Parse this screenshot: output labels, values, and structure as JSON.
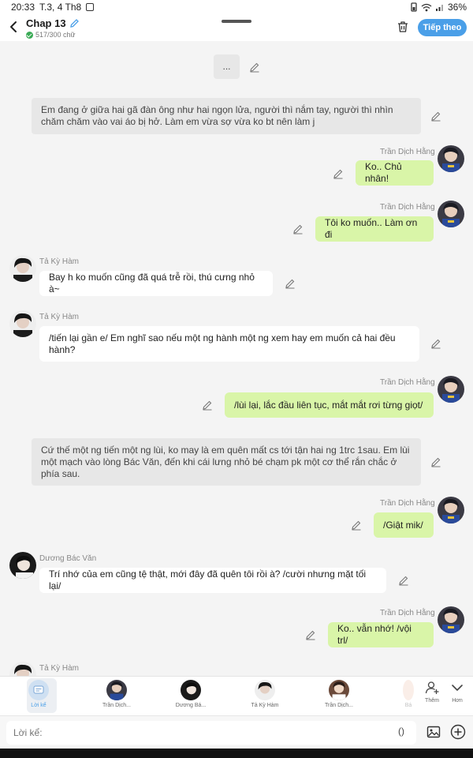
{
  "status_bar": {
    "time": "20:33",
    "date": "T.3, 4 Th8",
    "battery": "36%"
  },
  "header": {
    "title": "Chap 13",
    "word_count": "517/300 chữ",
    "next_label": "Tiếp theo"
  },
  "messages": [
    {
      "kind": "narration",
      "text": "..."
    },
    {
      "kind": "narration",
      "text": "Em đang ở giữa hai gã đàn ông như hai ngọn lửa, người thì nắm tay, người thì nhìn chăm chăm vào vai áo bị hở. Làm em vừa sợ vừa ko bt nên làm j"
    },
    {
      "kind": "right",
      "sender": "Trần Dịch Hằng",
      "text": "Ko.. Chủ nhân!"
    },
    {
      "kind": "right",
      "sender": "Trần Dịch Hằng",
      "text": "Tôi ko muốn.. Làm ơn đi"
    },
    {
      "kind": "left",
      "sender": "Tả Kỳ Hàm",
      "text": "Bay h ko muốn cũng đã quá trễ rồi, thú cưng nhỏ à~"
    },
    {
      "kind": "left",
      "sender": "Tả Kỳ Hàm",
      "text": "/tiến lại gần e/ Em nghĩ sao nếu một ng hành một ng xem hay em muốn cả hai đều hành?"
    },
    {
      "kind": "right",
      "sender": "Trần Dịch Hằng",
      "text": "/lùi lại, lắc đầu liên tục, mắt mắt rơi từng giọt/"
    },
    {
      "kind": "narration",
      "text": "Cứ thế một ng tiến một ng lùi, ko may là em quên mất cs tới tận hai ng 1trc 1sau. Em lùi một mạch vào lòng Bác Văn, đến khi cái lưng nhỏ bé chạm pk một cơ thể rắn chắc ở phía sau."
    },
    {
      "kind": "right",
      "sender": "Trần Dịch Hằng",
      "text": "/Giật mik/"
    },
    {
      "kind": "left",
      "sender": "Dương Bác Văn",
      "text": "Trí nhớ của em cũng tệ thật, mới đây đã quên tôi rồi à? /cười nhưng mặt tối lại/"
    },
    {
      "kind": "right",
      "sender": "Trần Dịch Hằng",
      "text": "Ko.. vẫn nhớ! /vội trl/"
    },
    {
      "kind": "left",
      "sender": "Tả Kỳ Hàm",
      "text": ""
    }
  ],
  "characters": [
    {
      "name": "Lời kể",
      "selected": true
    },
    {
      "name": "Trần Dịch..."
    },
    {
      "name": "Dương Bá..."
    },
    {
      "name": "Tả Kỳ Hàm"
    },
    {
      "name": "Trần Dịch..."
    },
    {
      "name": "Bá"
    }
  ],
  "actions": {
    "add_label": "Thêm",
    "more_label": "Hơn"
  },
  "composer": {
    "placeholder": "Lời kể:",
    "paren": "()"
  },
  "colors": {
    "accent": "#4a9fe8",
    "right_bubble": "#d9f5a8",
    "narration": "#e7e7e7"
  }
}
